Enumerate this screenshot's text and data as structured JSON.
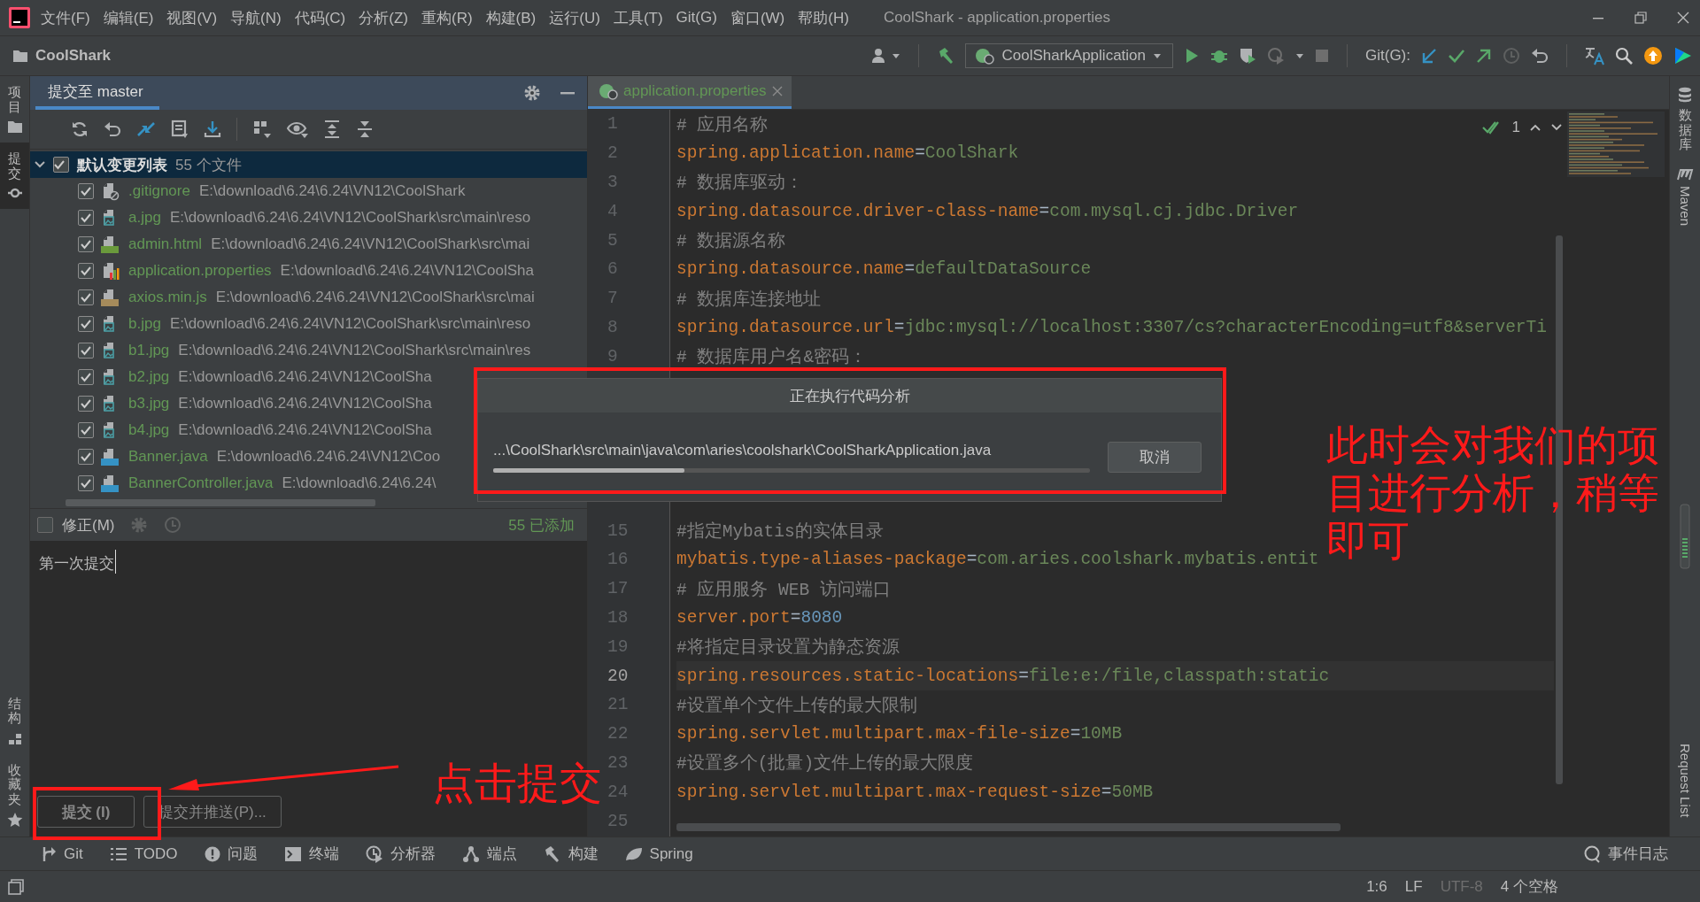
{
  "menu_bar": {
    "items": [
      "文件(F)",
      "编辑(E)",
      "视图(V)",
      "导航(N)",
      "代码(C)",
      "分析(Z)",
      "重构(R)",
      "构建(B)",
      "运行(U)",
      "工具(T)",
      "Git(G)",
      "窗口(W)",
      "帮助(H)"
    ],
    "title": "CoolShark - application.properties"
  },
  "toolbar": {
    "project": "CoolShark",
    "run_config": "CoolSharkApplication",
    "git_label": "Git(G):"
  },
  "left_stripe": [
    {
      "label": "项目",
      "selected": false
    },
    {
      "label": "提交",
      "selected": true
    },
    {
      "label": "结构",
      "selected": false
    },
    {
      "label": "收藏夹",
      "selected": false
    }
  ],
  "commit_panel": {
    "title": "提交至 master",
    "group": {
      "label": "默认变更列表",
      "count": "55 个文件",
      "checked": true,
      "expanded": true
    },
    "files": [
      {
        "name": ".gitignore",
        "path": "E:\\download\\6.24\\6.24\\VN12\\CoolShark",
        "kind": "ignore",
        "checked": true
      },
      {
        "name": "a.jpg",
        "path": "E:\\download\\6.24\\6.24\\VN12\\CoolShark\\src\\main\\reso",
        "kind": "image",
        "checked": true
      },
      {
        "name": "admin.html",
        "path": "E:\\download\\6.24\\6.24\\VN12\\CoolShark\\src\\mai",
        "kind": "html",
        "checked": true
      },
      {
        "name": "application.properties",
        "path": "E:\\download\\6.24\\6.24\\VN12\\CoolSha",
        "kind": "properties",
        "checked": true
      },
      {
        "name": "axios.min.js",
        "path": "E:\\download\\6.24\\6.24\\VN12\\CoolShark\\src\\mai",
        "kind": "js",
        "checked": true
      },
      {
        "name": "b.jpg",
        "path": "E:\\download\\6.24\\6.24\\VN12\\CoolShark\\src\\main\\reso",
        "kind": "image",
        "checked": true
      },
      {
        "name": "b1.jpg",
        "path": "E:\\download\\6.24\\6.24\\VN12\\CoolShark\\src\\main\\res",
        "kind": "image",
        "checked": true
      },
      {
        "name": "b2.jpg",
        "path": "E:\\download\\6.24\\6.24\\VN12\\CoolSha",
        "kind": "image",
        "checked": true
      },
      {
        "name": "b3.jpg",
        "path": "E:\\download\\6.24\\6.24\\VN12\\CoolSha",
        "kind": "image",
        "checked": true
      },
      {
        "name": "b4.jpg",
        "path": "E:\\download\\6.24\\6.24\\VN12\\CoolSha",
        "kind": "image",
        "checked": true
      },
      {
        "name": "Banner.java",
        "path": "E:\\download\\6.24\\6.24\\VN12\\Coo",
        "kind": "java",
        "checked": true
      },
      {
        "name": "BannerController.java",
        "path": "E:\\download\\6.24\\6.24\\",
        "kind": "java",
        "checked": true
      }
    ],
    "amend": {
      "label": "修正(M)",
      "checked": false
    },
    "added": "55 已添加",
    "message": "第一次提交",
    "buttons": [
      {
        "label": "提交 (I)"
      },
      {
        "label": "提交并推送(P)..."
      }
    ]
  },
  "editor": {
    "tab": {
      "label": "application.properties",
      "selected": true
    },
    "problems": "1",
    "lines": [
      {
        "kind": "comment",
        "num": "1",
        "text": "# 应用名称",
        "current": false
      },
      {
        "kind": "property",
        "num": "2",
        "key": "spring.application.name",
        "operator": "=",
        "value": {
          "kind": "string",
          "text": "CoolShark"
        },
        "current": false
      },
      {
        "kind": "comment",
        "num": "3",
        "text": "# 数据库驱动：",
        "current": false
      },
      {
        "kind": "property",
        "num": "4",
        "key": "spring.datasource.driver-class-name",
        "operator": "=",
        "value": {
          "kind": "string",
          "text": "com.mysql.cj.jdbc.Driver"
        },
        "current": false
      },
      {
        "kind": "comment",
        "num": "5",
        "text": "# 数据源名称",
        "current": false
      },
      {
        "kind": "property",
        "num": "6",
        "key": "spring.datasource.name",
        "operator": "=",
        "value": {
          "kind": "string",
          "text": "defaultDataSource"
        },
        "current": false
      },
      {
        "kind": "comment",
        "num": "7",
        "text": "# 数据库连接地址",
        "current": false
      },
      {
        "kind": "property",
        "num": "8",
        "key": "spring.datasource.url",
        "operator": "=",
        "value": {
          "kind": "string",
          "text": "jdbc:mysql://localhost:3307/cs?characterEncoding=utf8&serverTi"
        },
        "current": false
      },
      {
        "kind": "comment",
        "num": "9",
        "text": "# 数据库用户名&密码：",
        "current": false
      },
      {
        "kind": "hidden"
      },
      {
        "kind": "hidden"
      },
      {
        "kind": "hidden"
      },
      {
        "kind": "hidden"
      },
      {
        "kind": "hidden"
      },
      {
        "kind": "comment",
        "num": "15",
        "text": "#指定Mybatis的实体目录",
        "current": false
      },
      {
        "kind": "property",
        "num": "16",
        "key": "mybatis.type-aliases-package",
        "operator": "=",
        "value": {
          "kind": "string",
          "text": "com.aries.coolshark.mybatis.entit"
        },
        "current": false
      },
      {
        "kind": "comment",
        "num": "17",
        "text": "# 应用服务 WEB 访问端口",
        "current": false
      },
      {
        "kind": "property",
        "num": "18",
        "key": "server.port",
        "operator": "=",
        "value": {
          "kind": "number",
          "text": "8080"
        },
        "current": false
      },
      {
        "kind": "comment",
        "num": "19",
        "text": "#将指定目录设置为静态资源",
        "current": false
      },
      {
        "kind": "property",
        "num": "20",
        "key": "spring.resources.static-locations",
        "operator": "=",
        "value": {
          "kind": "string",
          "text": "file:e:/file,classpath:static"
        },
        "current": true
      },
      {
        "kind": "comment",
        "num": "21",
        "text": "#设置单个文件上传的最大限制",
        "current": false
      },
      {
        "kind": "property",
        "num": "22",
        "key": "spring.servlet.multipart.max-file-size",
        "operator": "=",
        "value": {
          "kind": "string",
          "text": "10MB"
        },
        "current": false
      },
      {
        "kind": "comment",
        "num": "23",
        "text": "#设置多个(批量)文件上传的最大限度",
        "current": false
      },
      {
        "kind": "property",
        "num": "24",
        "key": "spring.servlet.multipart.max-request-size",
        "operator": "=",
        "value": {
          "kind": "string",
          "text": "50MB"
        },
        "current": false
      },
      {
        "kind": "blank",
        "num": "25",
        "current": false
      }
    ]
  },
  "right_stripe": [
    {
      "label": "数据库",
      "kind": "cjk"
    },
    {
      "label": "Maven",
      "kind": "latin"
    },
    {
      "label": "Request List",
      "kind": "latin"
    }
  ],
  "tool_windows": [
    {
      "label": "Git"
    },
    {
      "label": "TODO"
    },
    {
      "label": "问题"
    },
    {
      "label": "终端"
    },
    {
      "label": "分析器"
    },
    {
      "label": "端点"
    },
    {
      "label": "构建"
    },
    {
      "label": "Spring"
    }
  ],
  "event_log": "事件日志",
  "status_bar": [
    "1:6",
    "LF",
    "UTF-8",
    "4 个空格"
  ],
  "dialog": {
    "title": "正在执行代码分析",
    "path": "...\\CoolShark\\src\\main\\java\\com\\aries\\coolshark\\CoolSharkApplication.java",
    "level": 0.32,
    "cancel": "取消"
  },
  "annotations": [
    {
      "text": "点击提交"
    },
    {
      "text": "此时会对我们的项目进行分析，稍等即可"
    }
  ]
}
